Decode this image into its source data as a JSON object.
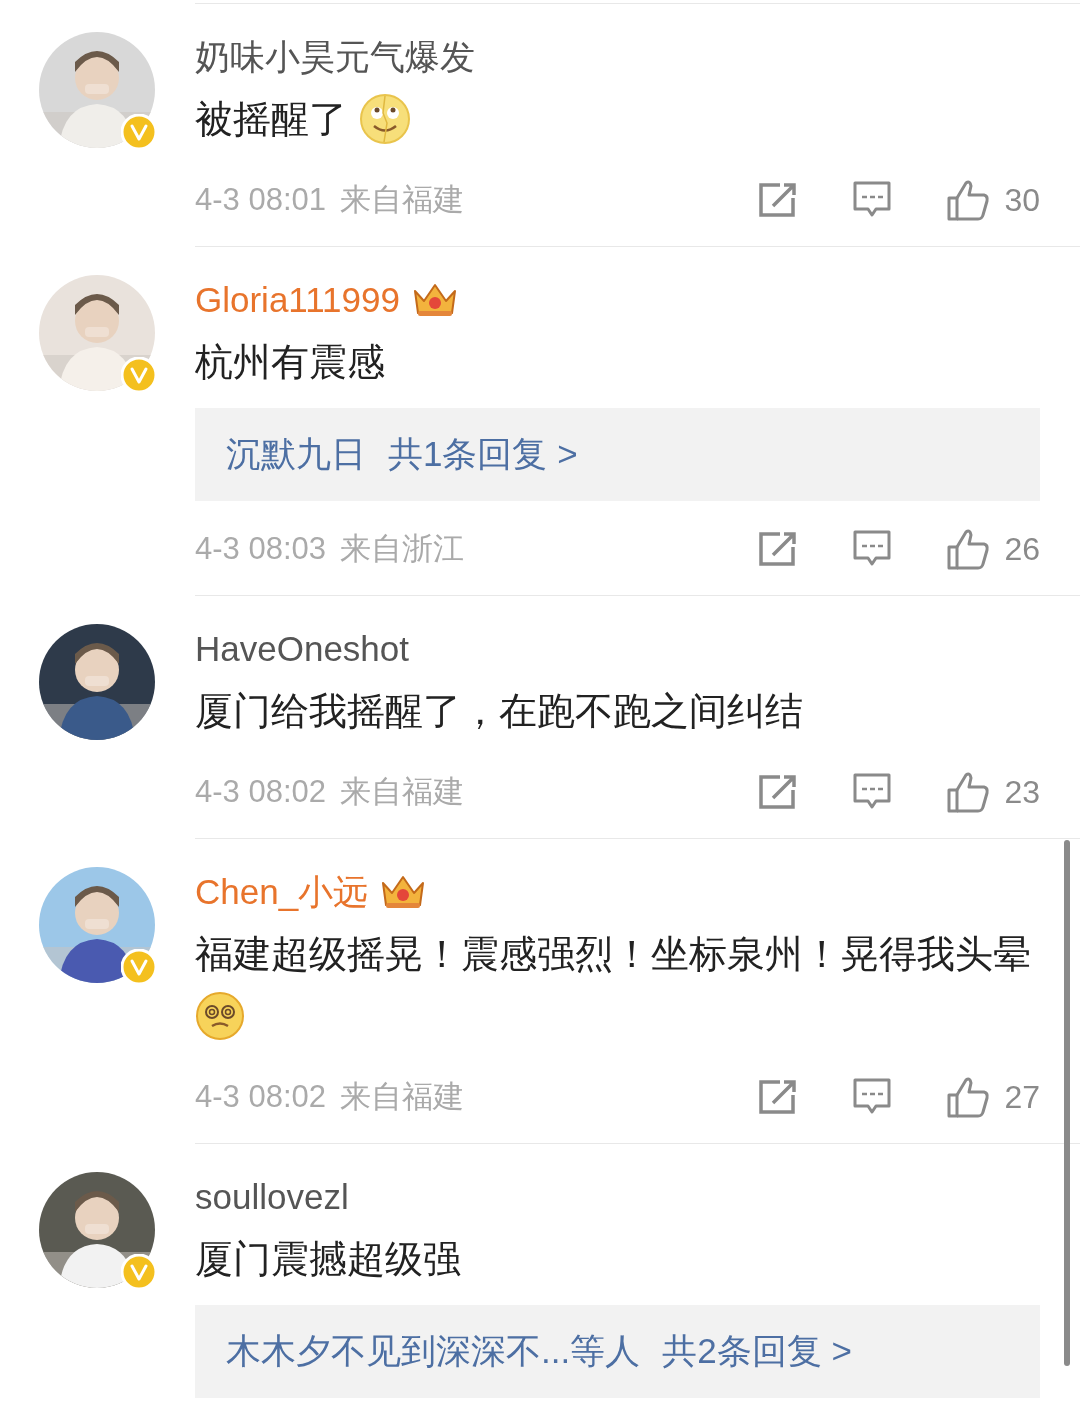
{
  "comments": [
    {
      "name": "奶味小昊元气爆发",
      "vip": false,
      "verified": true,
      "body": "被摇醒了",
      "emoji": {
        "kind": "rolling"
      },
      "time": "4-3 08:01",
      "location": "来自福建",
      "likes": "30"
    },
    {
      "name": "Gloria111999",
      "vip": true,
      "verified": true,
      "body": "杭州有震感",
      "reply": {
        "users": "沉默九日",
        "summary": "共1条回复 >"
      },
      "time": "4-3 08:03",
      "location": "来自浙江",
      "likes": "26"
    },
    {
      "name": "HaveOneshot",
      "vip": false,
      "verified": false,
      "body": "厦门给我摇醒了，在跑不跑之间纠结",
      "time": "4-3 08:02",
      "location": "来自福建",
      "likes": "23"
    },
    {
      "name": "Chen_小远",
      "vip": true,
      "verified": true,
      "body": "福建超级摇晃！震感强烈！坐标泉州！晃得我头晕",
      "emoji": {
        "kind": "dizzy"
      },
      "time": "4-3 08:02",
      "location": "来自福建",
      "likes": "27"
    },
    {
      "name": "soullovezl",
      "vip": false,
      "verified": true,
      "body": "厦门震撼超级强",
      "reply": {
        "users": "木木夕不见到深深不...等人",
        "summary": "共2条回复 >"
      }
    }
  ]
}
